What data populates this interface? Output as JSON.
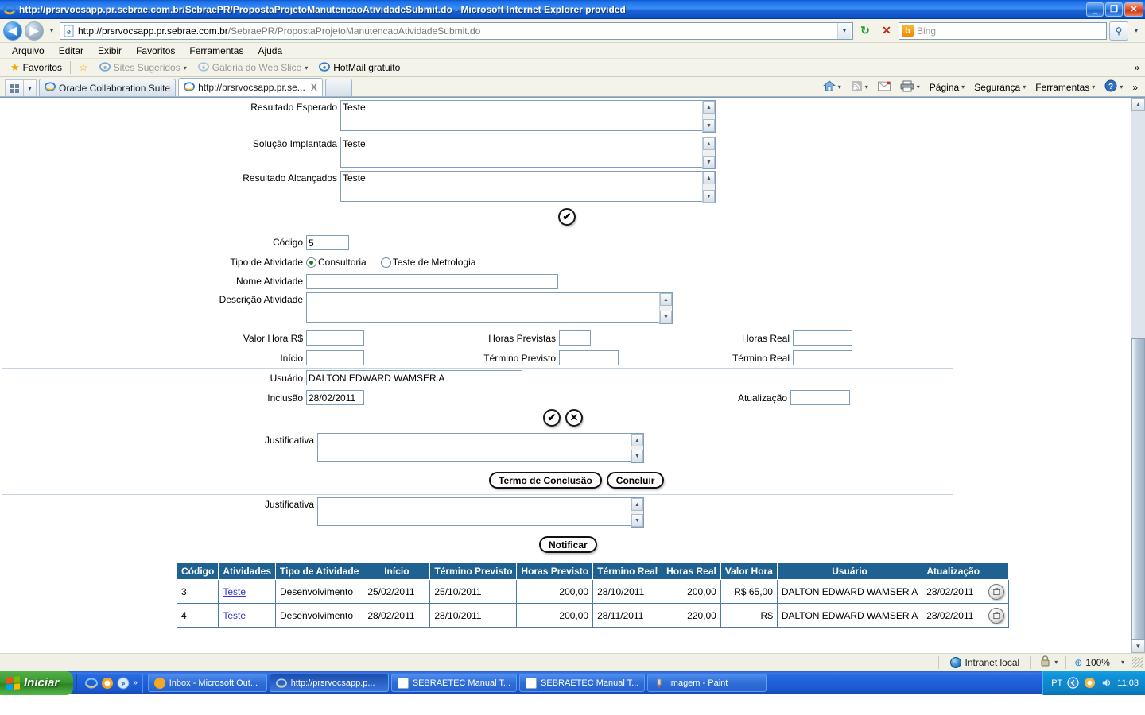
{
  "window": {
    "title": "http://prsrvocsapp.pr.sebrae.com.br/SebraePR/PropostaProjetoManutencaoAtividadeSubmit.do - Microsoft Internet Explorer provided",
    "minimize_label": "_",
    "maximize_label": "❐",
    "close_label": "✕"
  },
  "address_bar": {
    "back_label": "◀",
    "forward_label": "▶",
    "history_caret": "▾",
    "url_host": "http://prsrvocsapp.pr.sebrae.com.br",
    "url_path": "/SebraePR/PropostaProjetoManutencaoAtividadeSubmit.do",
    "url_dropdown_caret": "▾",
    "refresh_label": "↻",
    "stop_label": "✕",
    "search_engine": "Bing",
    "search_engine_initial": "b",
    "search_go_label": "⚲",
    "search_caret": "▾"
  },
  "menu": {
    "items": [
      "Arquivo",
      "Editar",
      "Exibir",
      "Favoritos",
      "Ferramentas",
      "Ajuda"
    ]
  },
  "favorites_bar": {
    "favoritos_label": "Favoritos",
    "star_icon": "★",
    "items": [
      {
        "label": "Sites Sugeridos",
        "has_caret": true,
        "dimmed": true
      },
      {
        "label": "Galeria do Web Slice",
        "has_caret": true,
        "dimmed": true
      },
      {
        "label": "HotMail gratuito",
        "has_caret": false,
        "dimmed": false
      }
    ],
    "overflow_label": "»"
  },
  "tabs": {
    "quicktab_caret": "▾",
    "items": [
      {
        "label": "Oracle Collaboration Suite",
        "active": false
      },
      {
        "label": "http://prsrvocsapp.pr.se...",
        "active": true,
        "close_label": "X"
      }
    ]
  },
  "command_bar": {
    "home_caret": "▾",
    "feeds_caret": "▾",
    "print_caret": "▾",
    "items": [
      {
        "label": "Página",
        "caret": "▾"
      },
      {
        "label": "Segurança",
        "caret": "▾"
      },
      {
        "label": "Ferramentas",
        "caret": "▾"
      }
    ],
    "help_label": "?",
    "help_caret": "▾",
    "overflow": "»"
  },
  "form": {
    "top_textareas": [
      {
        "label": "Resultado Esperado",
        "value": "Teste"
      },
      {
        "label": "Solução Implantada",
        "value": "Teste"
      },
      {
        "label": "Resultado Alcançados",
        "value": "Teste"
      }
    ],
    "save_top_icon": "✔",
    "codigo": {
      "label": "Código",
      "value": "5"
    },
    "tipo_atividade": {
      "label": "Tipo de Atividade",
      "options": [
        {
          "label": "Consultoria",
          "selected": true
        },
        {
          "label": "Teste de Metrologia",
          "selected": false
        }
      ]
    },
    "nome_atividade": {
      "label": "Nome Atividade",
      "value": ""
    },
    "descricao_atividade": {
      "label": "Descrição Atividade",
      "value": ""
    },
    "valor_hora": {
      "label": "Valor Hora R$",
      "value": ""
    },
    "horas_previstas": {
      "label": "Horas Previstas",
      "value": ""
    },
    "horas_real": {
      "label": "Horas Real",
      "value": ""
    },
    "inicio": {
      "label": "Início",
      "value": ""
    },
    "termino_previsto": {
      "label": "Término Previsto",
      "value": ""
    },
    "termino_real": {
      "label": "Término Real",
      "value": ""
    },
    "usuario": {
      "label": "Usuário",
      "value": "DALTON EDWARD WAMSER A"
    },
    "inclusao": {
      "label": "Inclusão",
      "value": "28/02/2011"
    },
    "atualizacao": {
      "label": "Atualização",
      "value": ""
    },
    "confirm_icon": "✔",
    "cancel_icon": "✕",
    "justificativa_1": {
      "label": "Justificativa",
      "value": ""
    },
    "btn_termo_conclusao": "Termo de Conclusão",
    "btn_concluir": "Concluir",
    "justificativa_2": {
      "label": "Justificativa",
      "value": ""
    },
    "btn_notificar": "Notificar",
    "scroll_up": "▲",
    "scroll_down": "▼"
  },
  "table": {
    "columns": [
      "Código",
      "Atividades",
      "Tipo de Atividade",
      "Início",
      "Término Previsto",
      "Horas Previsto",
      "Término Real",
      "Horas Real",
      "Valor Hora",
      "Usuário",
      "Atualização",
      ""
    ],
    "rows": [
      {
        "codigo": "3",
        "atividades": "Teste",
        "tipo": "Desenvolvimento",
        "inicio": "25/02/2011",
        "termino_previsto": "25/10/2011",
        "horas_previsto": "200,00",
        "termino_real": "28/10/2011",
        "horas_real": "200,00",
        "valor_hora": "R$ 65,00",
        "usuario": "DALTON EDWARD WAMSER A",
        "atualizacao": "28/02/2011",
        "delete_icon": "🗑"
      },
      {
        "codigo": "4",
        "atividades": "Teste",
        "tipo": "Desenvolvimento",
        "inicio": "28/02/2011",
        "termino_previsto": "28/10/2011",
        "horas_previsto": "200,00",
        "termino_real": "28/11/2011",
        "horas_real": "220,00",
        "valor_hora": "R$",
        "usuario": "DALTON EDWARD WAMSER A",
        "atualizacao": "28/02/2011",
        "delete_icon": "🗑"
      }
    ]
  },
  "status_bar": {
    "zone": "Intranet local",
    "security_caret": "▾",
    "zoom": "100%",
    "zoom_caret": "▾",
    "zoom_icon": "⊕"
  },
  "taskbar": {
    "start_label": "Iniciar",
    "quicklaunch_overflow": "»",
    "tasks": [
      {
        "label": "Inbox - Microsoft Out...",
        "active": false,
        "icon_color": "#f0a030"
      },
      {
        "label": "http://prsrvocsapp.p...",
        "active": true,
        "icon_color": "#2f7fd0"
      },
      {
        "label": "SEBRAETEC Manual T...",
        "active": false,
        "icon_color": "#ffffff"
      },
      {
        "label": "SEBRAETEC Manual T...",
        "active": false,
        "icon_color": "#ffffff"
      },
      {
        "label": "imagem - Paint",
        "active": false,
        "icon_color": "#e8e8e8"
      }
    ],
    "language": "PT",
    "clock": "11:03"
  },
  "colors": {
    "title_blue": "#1b6ee8",
    "table_header": "#1f6191",
    "link": "#3333cc",
    "field_border": "#7f9db9",
    "chrome_bg": "#f3f3ea"
  }
}
